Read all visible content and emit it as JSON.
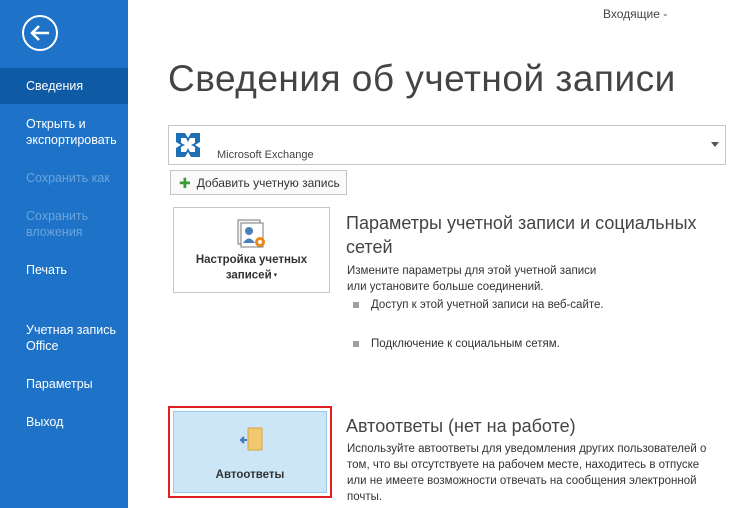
{
  "sidebar": {
    "items": [
      {
        "label": "Сведения"
      },
      {
        "label": "Открыть и экспортировать"
      },
      {
        "label": "Сохранить как"
      },
      {
        "label": "Сохранить вложения"
      },
      {
        "label": "Печать"
      },
      {
        "label": "Учетная запись Office"
      },
      {
        "label": "Параметры"
      },
      {
        "label": "Выход"
      }
    ]
  },
  "header": {
    "folder": "Входящие -"
  },
  "main": {
    "title": "Сведения об учетной записи",
    "account_selector": {
      "value": "Microsoft Exchange"
    },
    "add_account_label": "Добавить учетную запись",
    "account_settings": {
      "tile_label_line1": "Настройка учетных",
      "tile_label_line2": "записей",
      "title_line1": "Параметры учетной записи и социальных",
      "title_line2": "сетей",
      "description_line1": "Измените параметры для этой учетной записи",
      "description_line2": "или установите больше соединений.",
      "bullets": [
        {
          "text": "Доступ к этой учетной записи на веб-сайте."
        },
        {
          "text": "Подключение к социальным сетям."
        }
      ]
    },
    "auto_replies": {
      "tile_label": "Автоответы",
      "title": "Автоответы (нет на работе)",
      "description_line1": "Используйте автоответы для уведомления других пользователей о",
      "description_line2": "том, что вы отсутствуете на рабочем месте, находитесь в отпуске",
      "description_line3": "или не имеете возможности отвечать на сообщения электронной",
      "description_line4": "почты."
    }
  },
  "colors": {
    "sidebar_bg": "#1e73c8",
    "sidebar_active": "#0f5aa5",
    "highlight_border": "#e02020",
    "auto_tile_bg": "#cde6f7"
  }
}
